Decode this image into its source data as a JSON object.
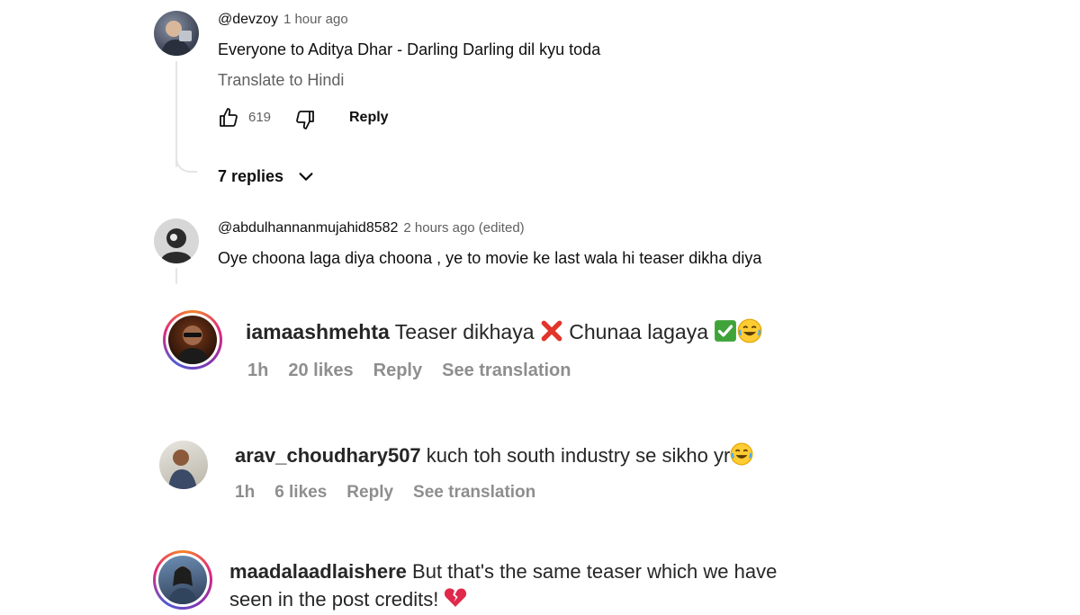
{
  "youtube_comments": [
    {
      "username": "@devzoy",
      "time": "1 hour ago",
      "text": "Everyone to Aditya Dhar - Darling Darling dil kyu toda",
      "translate": "Translate to Hindi",
      "likes": "619",
      "reply_label": "Reply",
      "replies_label": "7 replies"
    },
    {
      "username": "@abdulhannanmujahid8582",
      "time": "2 hours ago (edited)",
      "text": "Oye choona laga diya choona , ye to movie ke last wala hi teaser dikha diya"
    }
  ],
  "instagram_comments": [
    {
      "username": "iamaashmehta",
      "text_part1": "Teaser dikhaya",
      "text_part2": "Chunaa lagaya",
      "time": "1h",
      "likes": "20 likes",
      "reply_label": "Reply",
      "translation_label": "See translation"
    },
    {
      "username": "arav_choudhary507",
      "text": "kuch toh south industry se sikho yr",
      "time": "1h",
      "likes": "6 likes",
      "reply_label": "Reply",
      "translation_label": "See translation"
    },
    {
      "username": "maadalaadlaishere",
      "text_line1": "But that's the same teaser which we have",
      "text_line2": "seen in the post credits!"
    }
  ],
  "icons": [
    "thumbs-up-icon",
    "thumbs-down-icon",
    "chevron-down-icon",
    "cross-mark-emoji",
    "check-mark-emoji",
    "laughing-emoji",
    "broken-heart-emoji"
  ]
}
